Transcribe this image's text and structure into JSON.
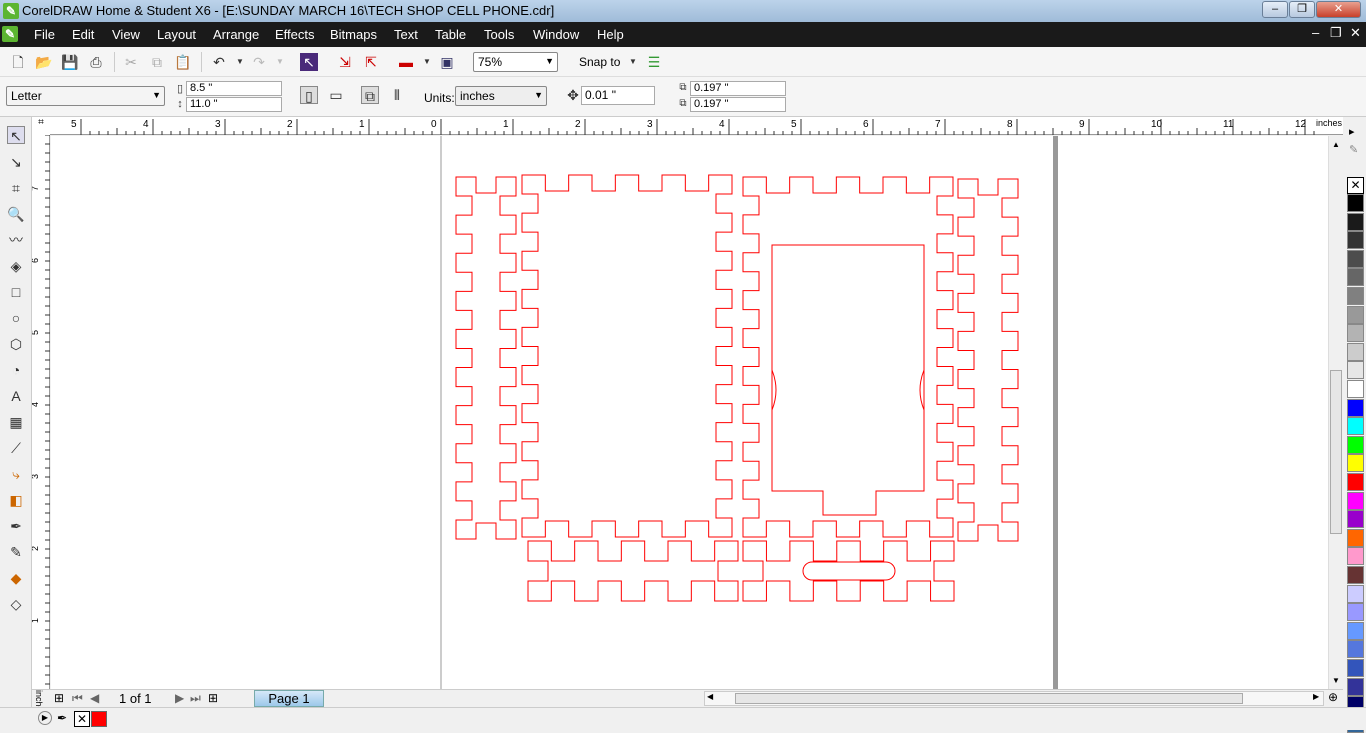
{
  "window": {
    "title": "CorelDRAW Home & Student X6 - [E:\\SUNDAY MARCH 16\\TECH SHOP CELL PHONE.cdr]",
    "minimize": "‒",
    "restore": "❐",
    "close": "✕"
  },
  "menu": [
    "File",
    "Edit",
    "View",
    "Layout",
    "Arrange",
    "Effects",
    "Bitmaps",
    "Text",
    "Table",
    "Tools",
    "Window",
    "Help"
  ],
  "toolbar": {
    "zoom": "75%",
    "snap_to": "Snap to"
  },
  "property_bar": {
    "page_size": "Letter",
    "width": "8.5 \"",
    "height": "11.0 \"",
    "units_label": "Units:",
    "units": "inches",
    "nudge": "0.01 \"",
    "dup_x": "0.197 \"",
    "dup_y": "0.197 \""
  },
  "rulers": {
    "unit": "inches",
    "h_labels": [
      "5",
      "4",
      "3",
      "2",
      "1",
      "0",
      "1",
      "2",
      "3",
      "4",
      "5",
      "6",
      "7",
      "8",
      "9",
      "10",
      "11",
      "12"
    ],
    "v_labels": [
      "7",
      "6",
      "5",
      "4",
      "3",
      "2",
      "1"
    ]
  },
  "pages": {
    "counter": "1 of 1",
    "tab": "Page 1"
  },
  "palette": [
    "#000000",
    "#1a1a1a",
    "#333333",
    "#4d4d4d",
    "#666666",
    "#808080",
    "#999999",
    "#b3b3b3",
    "#cccccc",
    "#e6e6e6",
    "#ffffff",
    "#0000ff",
    "#00ffff",
    "#00ff00",
    "#ffff00",
    "#ff0000",
    "#ff00ff",
    "#9900cc",
    "#ff6600",
    "#ff99cc",
    "#663333",
    "#ccccff",
    "#9999ff",
    "#6699ff",
    "#5577dd",
    "#3355bb",
    "#333399",
    "#000066",
    "#336699"
  ],
  "status": {
    "outline_color": "#ff0000"
  },
  "drawing": {
    "stroke": "#ff0000"
  }
}
